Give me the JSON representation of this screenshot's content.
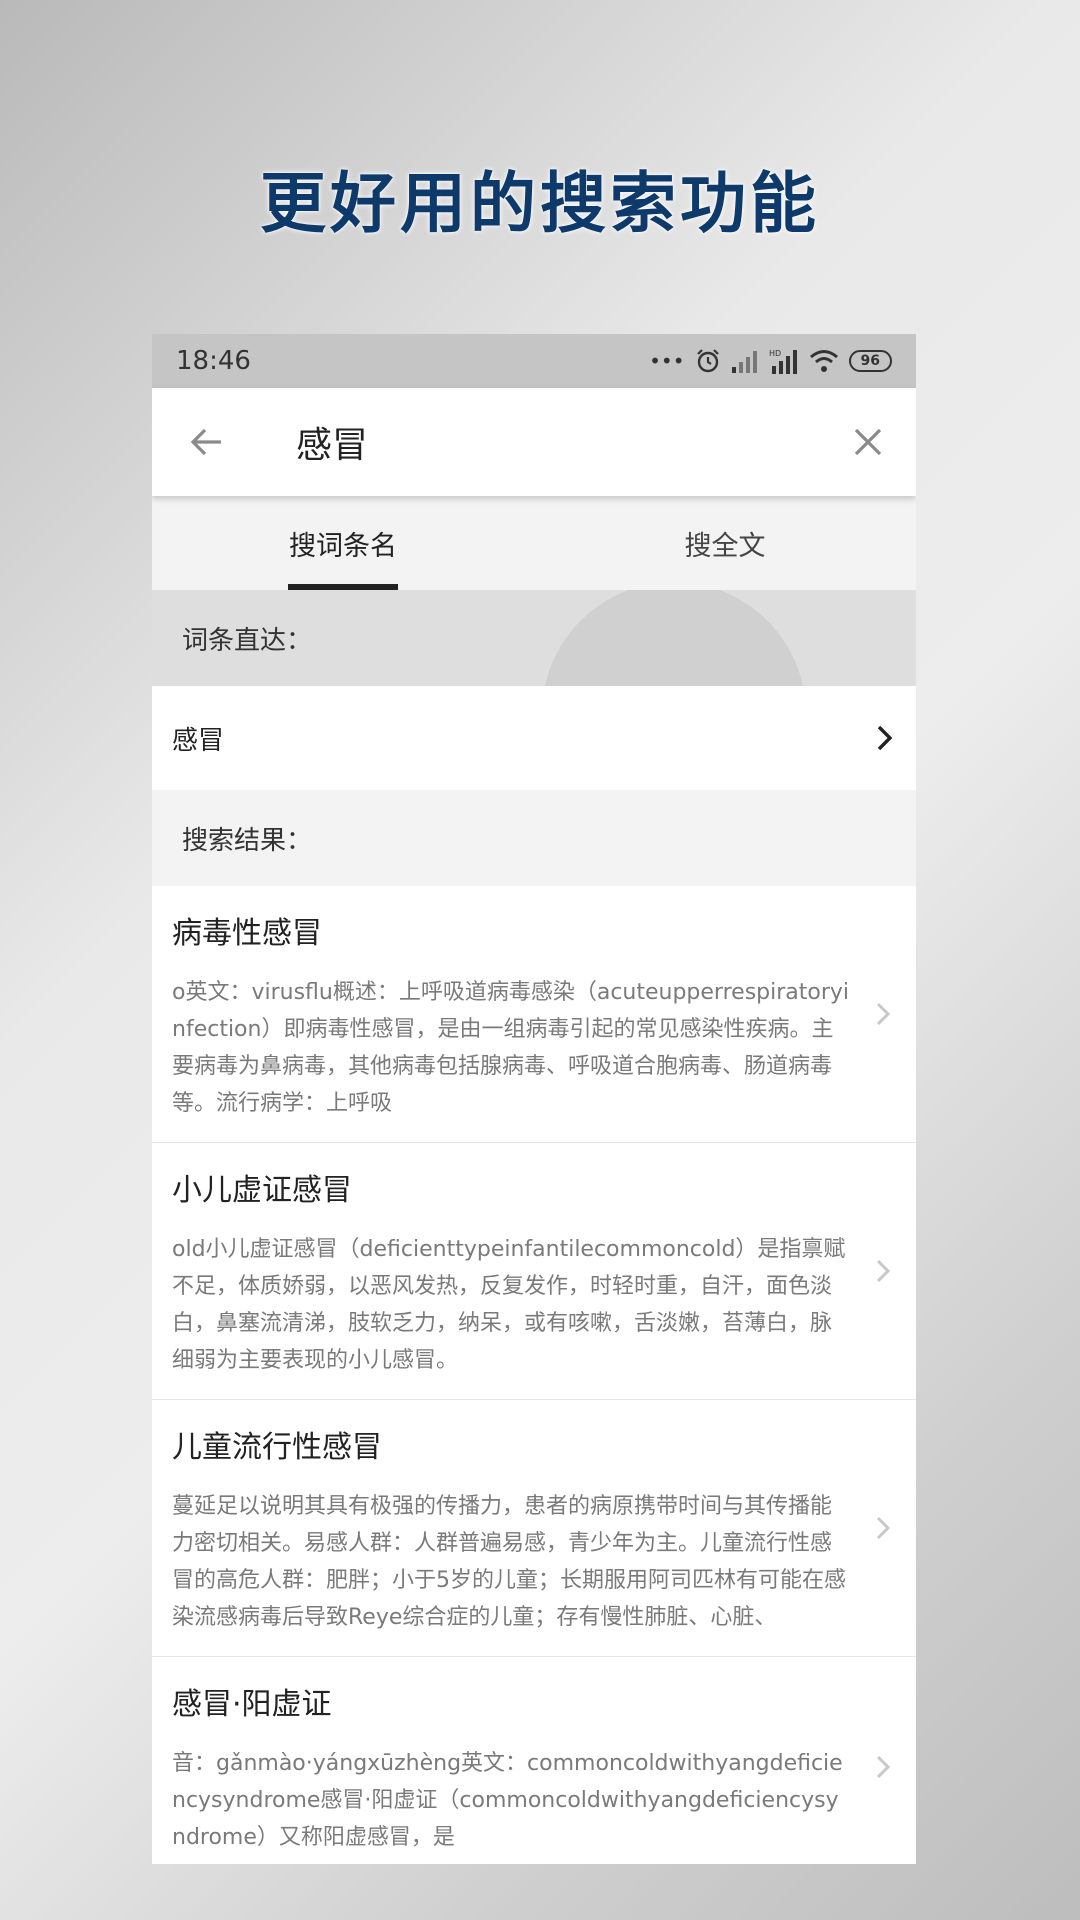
{
  "headline": "更好用的搜索功能",
  "statusbar": {
    "time": "18:46",
    "dots": "•••",
    "battery": "96"
  },
  "search": {
    "query": "感冒"
  },
  "tabs": [
    {
      "label": "搜词条名",
      "active": true
    },
    {
      "label": "搜全文",
      "active": false
    }
  ],
  "direct": {
    "header": "词条直达：",
    "item": "感冒"
  },
  "results_header": "搜索结果：",
  "results": [
    {
      "title": "病毒性感冒",
      "desc": "o英文：virusflu概述：上呼吸道病毒感染（acuteupperrespiratoryinfection）即病毒性感冒，是由一组病毒引起的常见感染性疾病。主要病毒为鼻病毒，其他病毒包括腺病毒、呼吸道合胞病毒、肠道病毒等。流行病学：上呼吸"
    },
    {
      "title": "小儿虚证感冒",
      "desc": "old小儿虚证感冒（deficienttypeinfantilecommoncold）是指禀赋不足，体质娇弱，以恶风发热，反复发作，时轻时重，自汗，面色淡白，鼻塞流清涕，肢软乏力，纳呆，或有咳嗽，舌淡嫩，苔薄白，脉细弱为主要表现的小儿感冒。"
    },
    {
      "title": "儿童流行性感冒",
      "desc": "蔓延足以说明其具有极强的传播力，患者的病原携带时间与其传播能力密切相关。易感人群：人群普遍易感，青少年为主。儿童流行性感冒的高危人群：肥胖；小于5岁的儿童；长期服用阿司匹林有可能在感染流感病毒后导致Reye综合症的儿童；存有慢性肺脏、心脏、"
    },
    {
      "title": "感冒·阳虚证",
      "desc": "音：gǎnmào·yángxūzhèng英文：commoncoldwithyangdeficiencysyndrome感冒·阳虚证（commoncoldwithyangdeficiencysyndrome）又称阳虚感冒，是"
    }
  ]
}
